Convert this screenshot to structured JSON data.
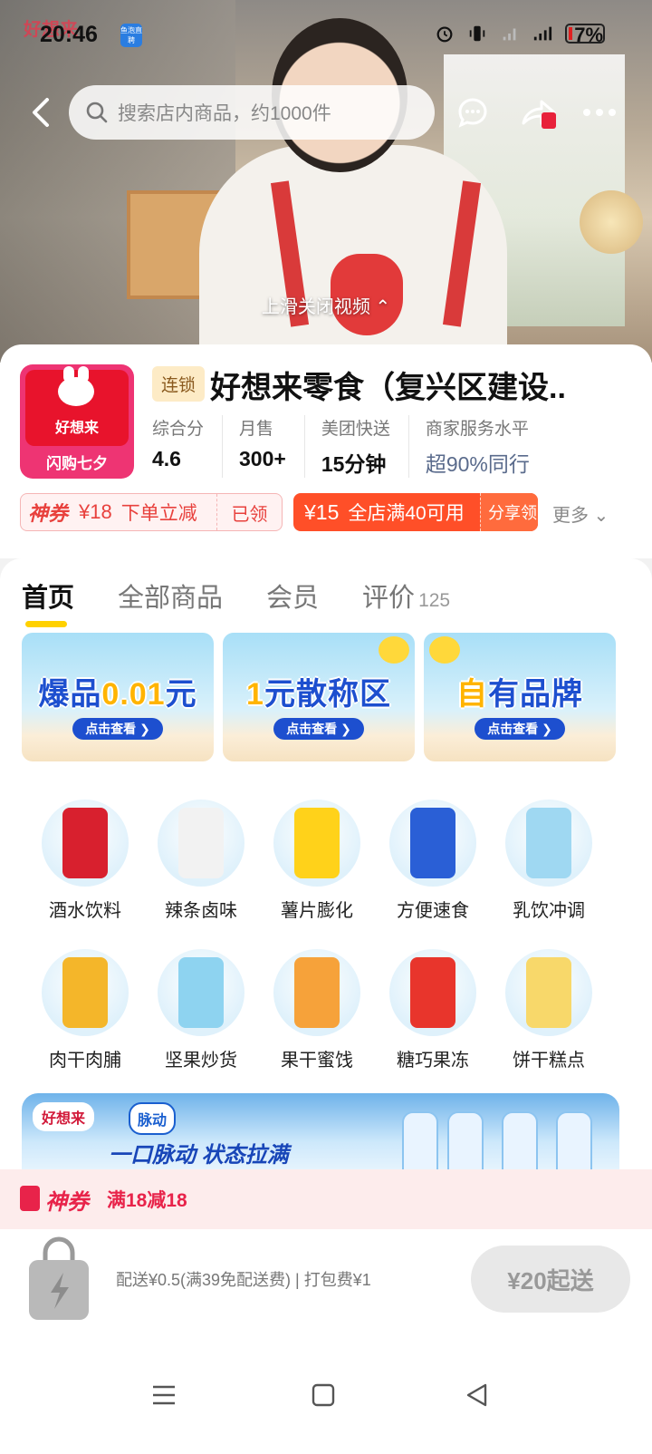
{
  "status": {
    "time": "20:46",
    "battery": "7%",
    "app_badge": "鱼泡直聘",
    "watermark": "好想来"
  },
  "search": {
    "placeholder": "搜索店内商品，约1000件"
  },
  "hero": {
    "hint": "上滑关闭视频 ⌃"
  },
  "store": {
    "logo_title": "好想来",
    "logo_sub": "闪购七夕",
    "chain_tag": "连锁",
    "name": "好想来零食（复兴区建设..",
    "stats": [
      {
        "label": "综合分",
        "value": "4.6"
      },
      {
        "label": "月售",
        "value": "300+"
      },
      {
        "label": "美团快送",
        "value": "15分钟"
      },
      {
        "label": "商家服务水平",
        "value": "超90%同行"
      }
    ]
  },
  "coupons": {
    "god_label": "神券",
    "god_amount": "¥18",
    "god_desc": "下单立减",
    "god_status": "已领",
    "shop_amount": "¥15",
    "shop_desc": "全店满40可用",
    "shop_action": "分享领",
    "more": "更多 ⌄"
  },
  "tabs": [
    {
      "label": "首页",
      "count": ""
    },
    {
      "label": "全部商品",
      "count": ""
    },
    {
      "label": "会员",
      "count": ""
    },
    {
      "label": "评价",
      "count": "125"
    }
  ],
  "banners": [
    {
      "pre": "爆品",
      "hl": "0.01",
      "post": "元",
      "button": "点击查看 ❯"
    },
    {
      "pre": "",
      "hl": "1",
      "post": "元散称区",
      "button": "点击查看 ❯"
    },
    {
      "pre": "",
      "hl": "自",
      "post": "有品牌",
      "button": "点击查看 ❯"
    }
  ],
  "categories": [
    {
      "label": "酒水饮料",
      "color": "#d8202e"
    },
    {
      "label": "辣条卤味",
      "color": "#f2f2f2"
    },
    {
      "label": "薯片膨化",
      "color": "#ffd21a"
    },
    {
      "label": "方便速食",
      "color": "#2a5fd6"
    },
    {
      "label": "乳饮冲调",
      "color": "#9fd8f2"
    },
    {
      "label": "肉干肉脯",
      "color": "#f4b62a"
    },
    {
      "label": "坚果炒货",
      "color": "#8ed3f0"
    },
    {
      "label": "果干蜜饯",
      "color": "#f6a23a"
    },
    {
      "label": "糖巧果冻",
      "color": "#e8352c"
    },
    {
      "label": "饼干糕点",
      "color": "#f8d86a"
    }
  ],
  "promo": {
    "brand": "好想来",
    "partner": "脉动",
    "slogan": "一口脉动 状态拉满"
  },
  "godbar": {
    "title": "神券",
    "desc": "满18减18"
  },
  "cart": {
    "info": "配送¥0.5(满39免配送费) | 打包费¥1",
    "start": "¥20起送"
  },
  "colors": {
    "accent": "#ffd100",
    "coupon_red": "#ff4f28",
    "brand_pink": "#ee3473"
  }
}
